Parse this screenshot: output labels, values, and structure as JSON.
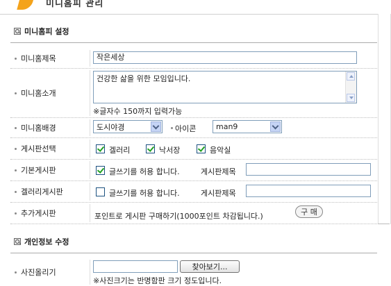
{
  "page": {
    "title": "미니홈피 관리"
  },
  "sections": {
    "homepage": {
      "title": "미니홈피 설정"
    },
    "personal": {
      "title": "개인정보 수정"
    }
  },
  "rows": {
    "title": {
      "label": "미니홈제목",
      "value": "작은세상"
    },
    "intro": {
      "label": "미니홈소개",
      "value": "건강한 삶을 위한 모임입니다.",
      "hint": "※글자수 150까지 입력가능"
    },
    "background": {
      "label": "미니홈배경",
      "selected": "도시야경",
      "icon_label": "아이콘",
      "icon_selected": "man9"
    },
    "board_select": {
      "label": "게시판선택",
      "options": [
        {
          "label": "겔러리",
          "checked": true
        },
        {
          "label": "낙서장",
          "checked": true
        },
        {
          "label": "음악실",
          "checked": true
        }
      ]
    },
    "basic_board": {
      "label": "기본게시판",
      "allow_label": "글쓰기를 허용 합니다.",
      "checked": true,
      "title_label": "게시판제목",
      "title_value": ""
    },
    "gallery_board": {
      "label": "겔러리게시판",
      "allow_label": "글쓰기를 허용 합니다.",
      "checked": false,
      "title_label": "게시판제목",
      "title_value": ""
    },
    "extra_board": {
      "label": "추가게시판",
      "text": "포인트로 게시판 구매하기(1000포인트 차감됩니다.)",
      "buy_label": "구 매"
    },
    "photo": {
      "label": "사진올리기",
      "browse_label": "찾아보기...",
      "hint": "※사진크기는 반명함판 크기 정도입니다."
    }
  },
  "icons": {
    "section": "magnifier-icon",
    "logo": "page-logo-icon"
  }
}
